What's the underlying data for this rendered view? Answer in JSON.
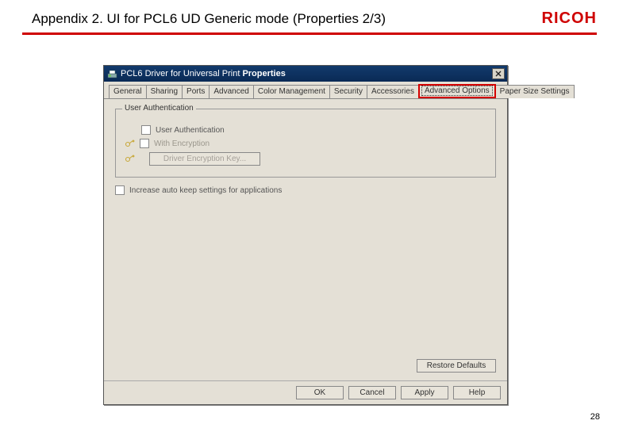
{
  "slide": {
    "title": "Appendix 2. UI for PCL6 UD Generic mode (Properties 2/3)",
    "brand": "RICOH",
    "page_number": "28"
  },
  "dialog": {
    "title_prefix": "PCL6 Driver for Universal Print ",
    "title_bold": "Properties",
    "tabs": {
      "general": "General",
      "sharing": "Sharing",
      "ports": "Ports",
      "advanced": "Advanced",
      "color": "Color Management",
      "security": "Security",
      "accessories": "Accessories",
      "adv_options": "Advanced Options",
      "paper_size": "Paper Size Settings"
    },
    "group": {
      "title": "User Authentication",
      "user_auth_label": "User Authentication",
      "with_encryption_label": "With Encryption",
      "driver_key_button": "Driver Encryption Key..."
    },
    "increase_auto_keep": "Increase auto keep settings for applications",
    "restore_defaults": "Restore Defaults",
    "buttons": {
      "ok": "OK",
      "cancel": "Cancel",
      "apply": "Apply",
      "help": "Help"
    }
  }
}
